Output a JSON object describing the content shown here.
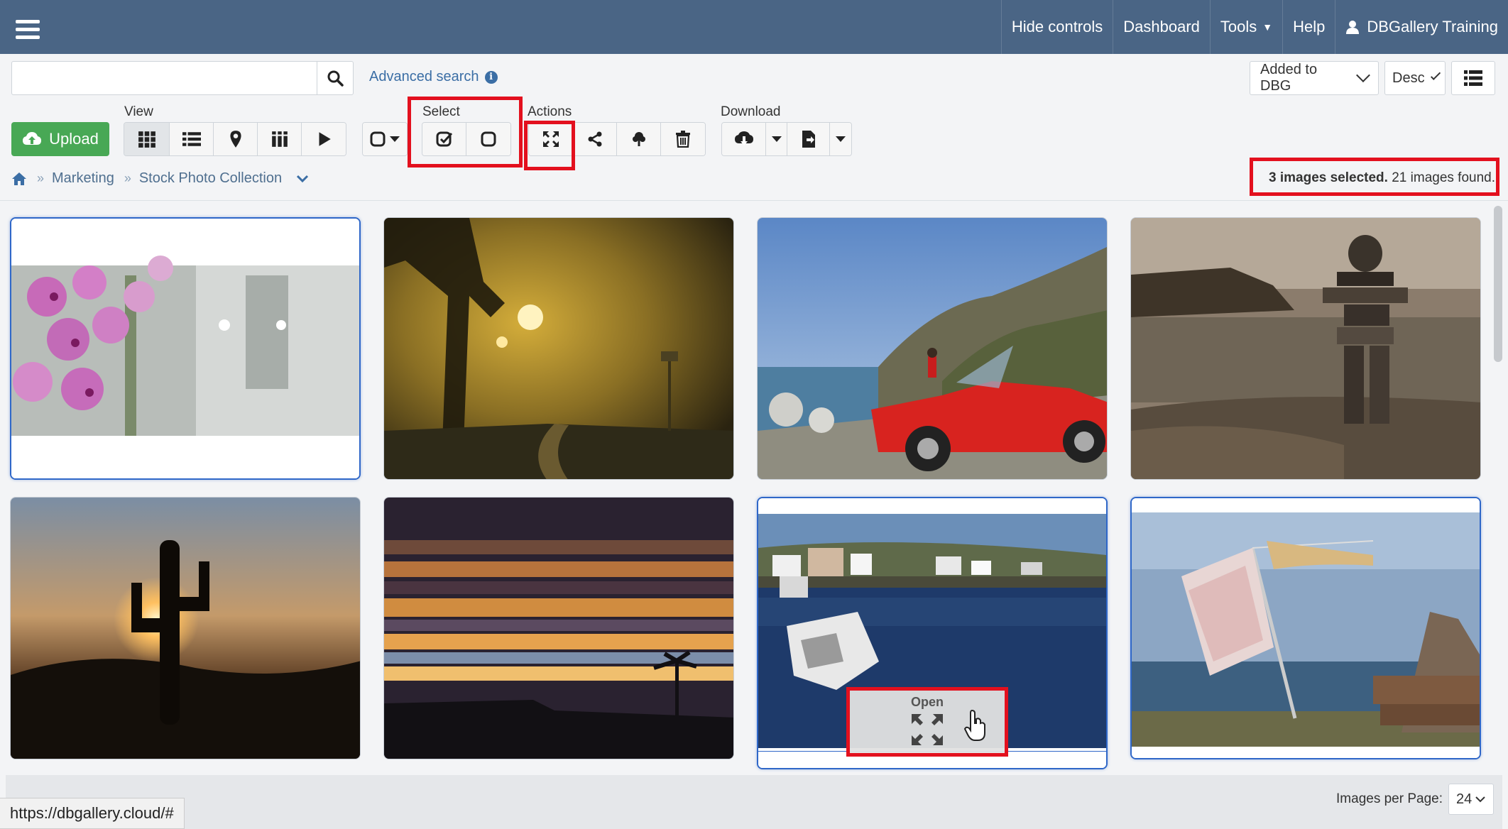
{
  "topnav": {
    "hide_controls": "Hide controls",
    "dashboard": "Dashboard",
    "tools": "Tools",
    "help": "Help",
    "user": "DBGallery Training"
  },
  "search": {
    "placeholder": "",
    "advanced_label": "Advanced search"
  },
  "sort": {
    "field": "Added to DBG",
    "order": "Desc"
  },
  "toolbar": {
    "upload_label": "Upload",
    "view_label": "View",
    "select_label": "Select",
    "actions_label": "Actions",
    "download_label": "Download"
  },
  "breadcrumb": {
    "items": [
      "Marketing",
      "Stock Photo Collection"
    ]
  },
  "status": {
    "selected": "3 images selected.",
    "found": "21 images found."
  },
  "overlay": {
    "open_label": "Open"
  },
  "footer": {
    "ipp_label": "Images per Page:",
    "ipp_value": "24",
    "url_tooltip": "https://dbgallery.cloud/#"
  },
  "images": [
    {
      "subject": "pink orchids",
      "selected": true
    },
    {
      "subject": "foggy street at night",
      "selected": false
    },
    {
      "subject": "red convertible on coast",
      "selected": false
    },
    {
      "subject": "inukshuk on rocky shore",
      "selected": false
    },
    {
      "subject": "cactus silhouette sunset",
      "selected": false
    },
    {
      "subject": "striped sunset with palm",
      "selected": false
    },
    {
      "subject": "harbour with boats",
      "selected": true
    },
    {
      "subject": "laundry on line by sea",
      "selected": true
    }
  ],
  "colors": {
    "topbar": "#4a6585",
    "upload": "#48a855",
    "highlight": "#e3101e",
    "selected_border": "#2f67c8"
  }
}
